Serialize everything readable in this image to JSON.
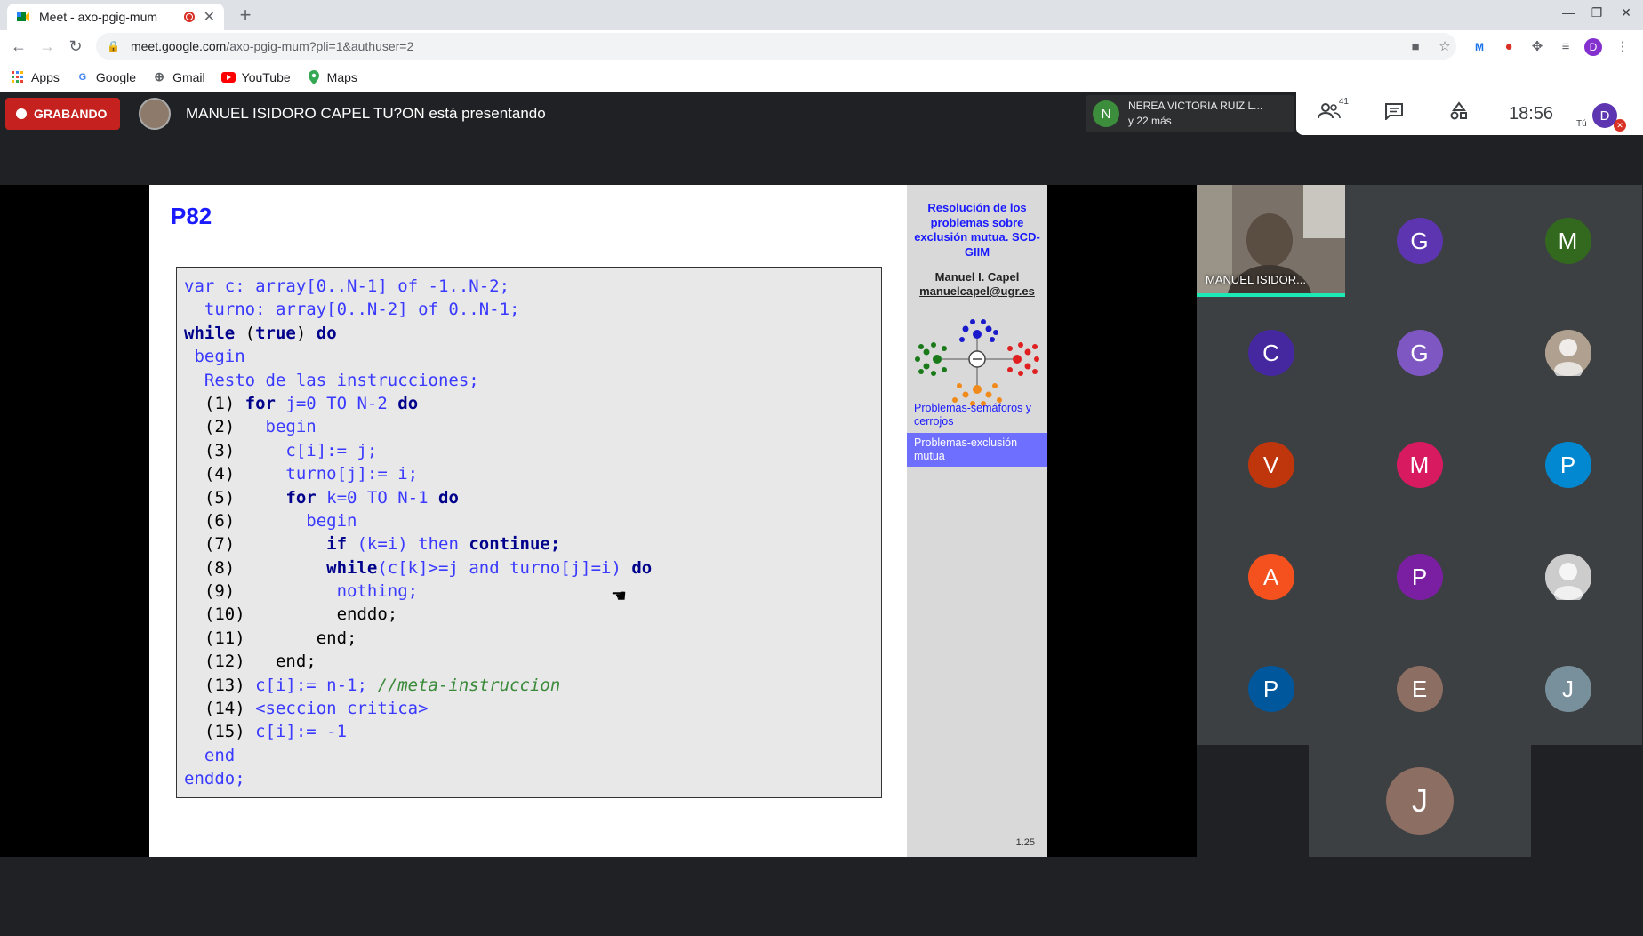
{
  "browser": {
    "tab_title": "Meet - axo-pgig-mum",
    "url_host": "meet.google.com",
    "url_path": "/axo-pgig-mum?pli=1&authuser=2",
    "profile_initial": "D"
  },
  "bookmarks": [
    "Apps",
    "Google",
    "Gmail",
    "YouTube",
    "Maps"
  ],
  "meet": {
    "recording_label": "GRABANDO",
    "presenting_text": "MANUEL ISIDORO CAPEL TU?ON está presentando",
    "speaker_name": "NEREA VICTORIA RUIZ L...",
    "speaker_initial": "N",
    "speaker_more": "y 22 más",
    "participant_count": "41",
    "time": "18:56",
    "self_label": "Tú",
    "self_initial": "D"
  },
  "slide": {
    "title": "P82",
    "sidebar_title": "Resolución de los problemas sobre exclusión mutua. SCD-GIIM",
    "author": "Manuel I. Capel",
    "email": "manuelcapel@ugr.es",
    "link1": "Problemas-semáforos y cerrojos",
    "link2": "Problemas-exclusión mutua",
    "page": "1.25"
  },
  "participants": {
    "video_name": "MANUEL ISIDOR...",
    "tiles": [
      {
        "initial": "G",
        "color": "#5e35b1"
      },
      {
        "initial": "M",
        "color": "#33691e"
      },
      {
        "initial": "C",
        "color": "#4527a0"
      },
      {
        "initial": "G",
        "color": "#7e57c2"
      },
      {
        "initial": "",
        "color": "#b0a090"
      },
      {
        "initial": "V",
        "color": "#bf360c"
      },
      {
        "initial": "M",
        "color": "#d81b60"
      },
      {
        "initial": "P",
        "color": "#0288d1"
      },
      {
        "initial": "A",
        "color": "#f4511e"
      },
      {
        "initial": "P",
        "color": "#7b1fa2"
      },
      {
        "initial": "",
        "color": "#cccccc"
      },
      {
        "initial": "P",
        "color": "#01579b"
      },
      {
        "initial": "E",
        "color": "#8d6e63"
      },
      {
        "initial": "J",
        "color": "#78909c"
      },
      {
        "initial": "J",
        "color": "#8d6e63"
      }
    ]
  },
  "code": [
    [
      [
        "var c: array[0..N-1] of -1..N-2;",
        "bl"
      ]
    ],
    [
      [
        "  turno: array[0..N-2] of 0..N-1;",
        "bl"
      ]
    ],
    [
      [
        "while",
        "kw"
      ],
      [
        " (",
        ""
      ],
      [
        "true",
        "kw"
      ],
      [
        ") ",
        ""
      ],
      [
        "do",
        "kw"
      ]
    ],
    [
      [
        " begin",
        "bl"
      ]
    ],
    [
      [
        "  Resto de las instrucciones;",
        "bl"
      ]
    ],
    [
      [
        "  (1) ",
        ""
      ],
      [
        "for",
        "kw"
      ],
      [
        " j=0 TO N-2 ",
        "bl"
      ],
      [
        "do",
        "kw"
      ]
    ],
    [
      [
        "  (2)   ",
        ""
      ],
      [
        "begin",
        "bl"
      ]
    ],
    [
      [
        "  (3)     ",
        ""
      ],
      [
        "c[i]:= j;",
        "bl"
      ]
    ],
    [
      [
        "  (4)     ",
        ""
      ],
      [
        "turno[j]:= i;",
        "bl"
      ]
    ],
    [
      [
        "  (5)     ",
        ""
      ],
      [
        "for",
        "kw"
      ],
      [
        " k=0 TO N-1 ",
        "bl"
      ],
      [
        "do",
        "kw"
      ]
    ],
    [
      [
        "  (6)       ",
        ""
      ],
      [
        "begin",
        "bl"
      ]
    ],
    [
      [
        "  (7)         ",
        ""
      ],
      [
        "if",
        "kw"
      ],
      [
        " (k=i) ",
        "bl"
      ],
      [
        "then",
        "bl"
      ],
      [
        " ",
        ""
      ],
      [
        "continue;",
        "kw"
      ]
    ],
    [
      [
        "  (8)         ",
        ""
      ],
      [
        "while",
        "kw"
      ],
      [
        "(c[k]>=j ",
        "bl"
      ],
      [
        "and",
        "bl"
      ],
      [
        " turno[j]=i) ",
        "bl"
      ],
      [
        "do",
        "kw"
      ]
    ],
    [
      [
        "  (9)          ",
        ""
      ],
      [
        "nothing;",
        "bl"
      ]
    ],
    [
      [
        "  (10)         ",
        ""
      ],
      [
        "enddo;",
        ""
      ]
    ],
    [
      [
        "  (11)       ",
        ""
      ],
      [
        "end;",
        ""
      ]
    ],
    [
      [
        "  (12)   ",
        ""
      ],
      [
        "end;",
        ""
      ]
    ],
    [
      [
        "  (13) ",
        ""
      ],
      [
        "c[i]:= n-1; ",
        "bl"
      ],
      [
        "//meta-instruccion",
        "cm"
      ]
    ],
    [
      [
        "  (14) ",
        ""
      ],
      [
        "<seccion critica>",
        "bl"
      ]
    ],
    [
      [
        "  (15) ",
        ""
      ],
      [
        "c[i]:= -1",
        "bl"
      ]
    ],
    [
      [
        "  end",
        "bl"
      ]
    ],
    [
      [
        "enddo;",
        "bl"
      ]
    ]
  ]
}
